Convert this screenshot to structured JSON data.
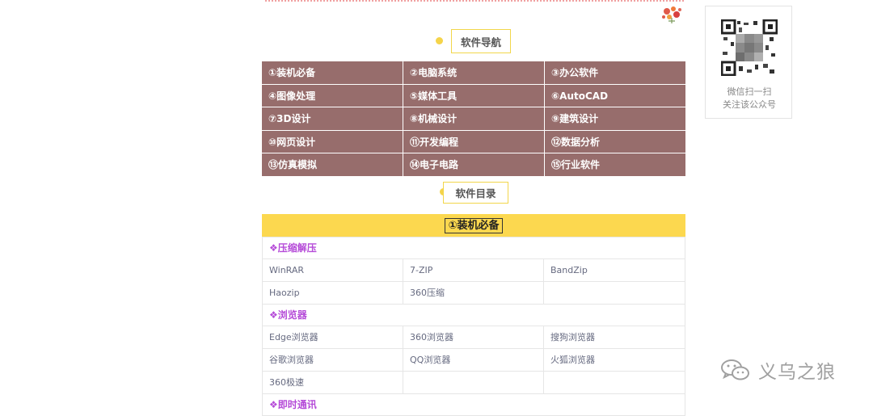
{
  "navigation": {
    "title": "软件导航",
    "items": [
      "①装机必备",
      "②电脑系统",
      "③办公软件",
      "④图像处理",
      "⑤媒体工具",
      "⑥AutoCAD",
      "⑦3D设计",
      "⑧机械设计",
      "⑨建筑设计",
      "⑩网页设计",
      "⑪开发编程",
      "⑫数据分析",
      "⑬仿真模拟",
      "⑭电子电路",
      "⑮行业软件"
    ]
  },
  "catalog": {
    "title": "软件目录",
    "section_title": "①装机必备",
    "groups": [
      {
        "name": "❖压缩解压",
        "rows": [
          [
            "WinRAR",
            "7-ZIP",
            "BandZip"
          ],
          [
            "Haozip",
            "360压缩",
            ""
          ]
        ]
      },
      {
        "name": "❖浏览器",
        "rows": [
          [
            "Edge浏览器",
            "360浏览器",
            "搜狗浏览器"
          ],
          [
            "谷歌浏览器",
            "QQ浏览器",
            "火狐浏览器"
          ],
          [
            "360极速",
            "",
            ""
          ]
        ]
      },
      {
        "name": "❖即时通讯",
        "rows": []
      }
    ]
  },
  "qr_card": {
    "line1": "微信扫一扫",
    "line2": "关注该公众号"
  },
  "watermark": {
    "text": "义乌之狼",
    "icon": "wechat-icon"
  },
  "colors": {
    "nav_bg": "#976d6c",
    "accent_yellow": "#fcd84f",
    "group_purple": "#b54bd8"
  }
}
